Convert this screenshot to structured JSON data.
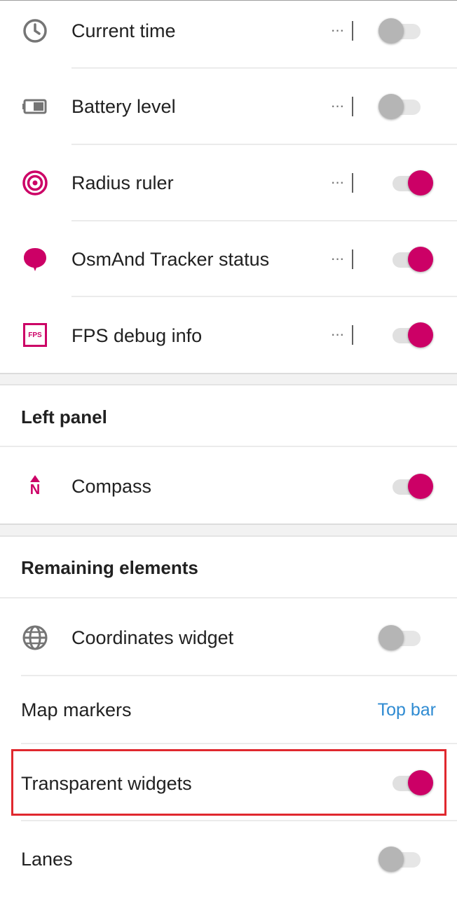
{
  "colors": {
    "accent": "#cc0066",
    "link": "#2f8bd2",
    "highlight": "#e0282e"
  },
  "widgets_top": [
    {
      "label": "Current time",
      "icon": "clock-icon",
      "has_menu": true,
      "enabled": false
    },
    {
      "label": "Battery level",
      "icon": "battery-icon",
      "has_menu": true,
      "enabled": false
    },
    {
      "label": "Radius ruler",
      "icon": "radius-ruler-icon",
      "has_menu": true,
      "enabled": true
    },
    {
      "label": "OsmAnd Tracker status",
      "icon": "tracker-icon",
      "has_menu": true,
      "enabled": true
    },
    {
      "label": "FPS debug info",
      "icon": "fps-icon",
      "icon_text": "FPS",
      "has_menu": true,
      "enabled": true
    }
  ],
  "left_panel": {
    "title": "Left panel",
    "items": [
      {
        "label": "Compass",
        "icon": "compass-icon",
        "icon_text": "N",
        "enabled": true
      }
    ]
  },
  "remaining": {
    "title": "Remaining elements",
    "coordinates": {
      "label": "Coordinates widget",
      "icon": "globe-icon",
      "enabled": false
    },
    "map_markers": {
      "label": "Map markers",
      "value": "Top bar"
    },
    "transparent": {
      "label": "Transparent widgets",
      "enabled": true
    },
    "lanes": {
      "label": "Lanes",
      "enabled": false
    }
  }
}
